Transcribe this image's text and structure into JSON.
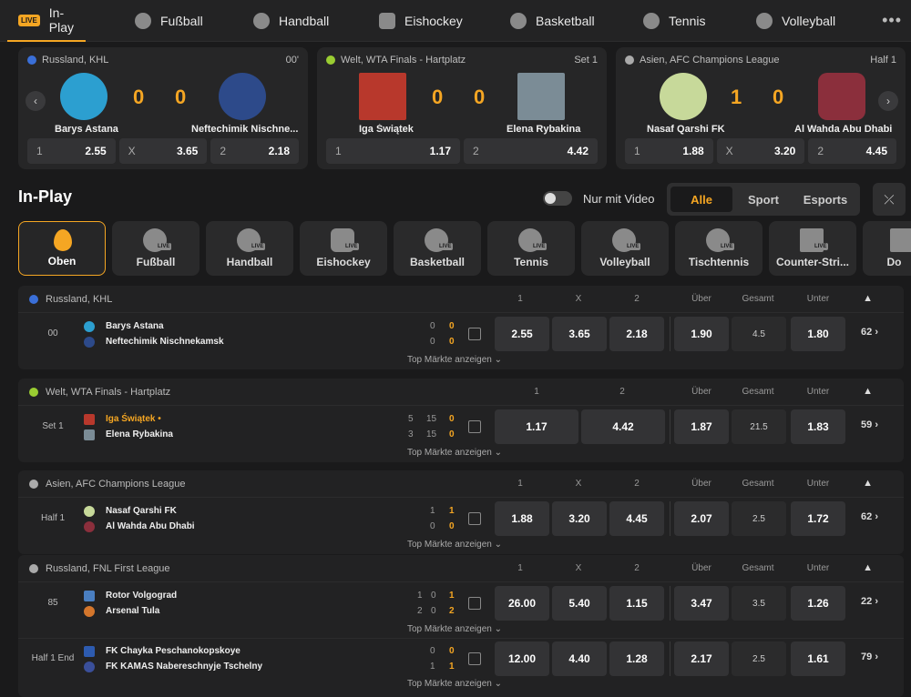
{
  "nav": {
    "items": [
      {
        "label": "In-Play",
        "icon": "live-icon",
        "active": true
      },
      {
        "label": "Fußball",
        "icon": "soccer-ball-icon"
      },
      {
        "label": "Handball",
        "icon": "handball-icon"
      },
      {
        "label": "Eishockey",
        "icon": "hockey-puck-icon"
      },
      {
        "label": "Basketball",
        "icon": "basketball-icon"
      },
      {
        "label": "Tennis",
        "icon": "tennis-ball-icon"
      },
      {
        "label": "Volleyball",
        "icon": "volleyball-icon"
      }
    ],
    "live_badge": "LIVE",
    "more": "•••"
  },
  "featured": [
    {
      "league": "Russland, KHL",
      "status": "00'",
      "home": "Barys Astana",
      "away": "Neftechimik Nischne...",
      "home_score": "0",
      "away_score": "0",
      "odds": [
        {
          "label": "1",
          "value": "2.55"
        },
        {
          "label": "X",
          "value": "3.65"
        },
        {
          "label": "2",
          "value": "2.18"
        }
      ]
    },
    {
      "league": "Welt, WTA Finals - Hartplatz",
      "status": "Set 1",
      "home": "Iga Świątek",
      "away": "Elena Rybakina",
      "home_score": "0",
      "away_score": "0",
      "odds": [
        {
          "label": "1",
          "value": "1.17"
        },
        {
          "label": "2",
          "value": "4.42"
        }
      ]
    },
    {
      "league": "Asien, AFC Champions League",
      "status": "Half 1",
      "home": "Nasaf Qarshi FK",
      "away": "Al Wahda Abu Dhabi",
      "home_score": "1",
      "away_score": "0",
      "odds": [
        {
          "label": "1",
          "value": "1.88"
        },
        {
          "label": "X",
          "value": "3.20"
        },
        {
          "label": "2",
          "value": "4.45"
        }
      ]
    }
  ],
  "inplay": {
    "title": "In-Play",
    "video_toggle_label": "Nur mit Video",
    "filters": [
      "Alle",
      "Sport",
      "Esports"
    ],
    "collapse_icon": "⤫"
  },
  "sports": [
    {
      "label": "Oben",
      "active": true
    },
    {
      "label": "Fußball"
    },
    {
      "label": "Handball"
    },
    {
      "label": "Eishockey"
    },
    {
      "label": "Basketball"
    },
    {
      "label": "Tennis"
    },
    {
      "label": "Volleyball"
    },
    {
      "label": "Tischtennis"
    },
    {
      "label": "Counter-Stri..."
    },
    {
      "label": "Do"
    }
  ],
  "tile_live": "LIVE",
  "top_markets_label": "Top Märkte anzeigen ⌄",
  "groups": [
    {
      "league": "Russland, KHL",
      "headers": {
        "c1": "1",
        "cx": "X",
        "c2": "2",
        "over": "Über",
        "total": "Gesamt",
        "under": "Unter"
      },
      "matches": [
        {
          "status": "00",
          "home": "Barys Astana",
          "away": "Neftechimik Nischnekamsk",
          "home_scores": [
            "0",
            "0"
          ],
          "away_scores": [
            "0",
            "0"
          ],
          "o1": "2.55",
          "ox": "3.65",
          "o2": "2.18",
          "over": "1.90",
          "line": "4.5",
          "under": "1.80",
          "more": "62 ›"
        }
      ]
    },
    {
      "league": "Welt, WTA Finals - Hartplatz",
      "headers": {
        "c1": "1",
        "c2": "2",
        "over": "Über",
        "total": "Gesamt",
        "under": "Unter"
      },
      "matches": [
        {
          "status": "Set 1",
          "home": "Iga Świątek •",
          "away": "Elena Rybakina",
          "home_scores": [
            "5",
            "15",
            "0"
          ],
          "away_scores": [
            "3",
            "15",
            "0"
          ],
          "o1": "1.17",
          "o2": "4.42",
          "over": "1.87",
          "line": "21.5",
          "under": "1.83",
          "more": "59 ›"
        }
      ]
    },
    {
      "league": "Asien, AFC Champions League",
      "headers": {
        "c1": "1",
        "cx": "X",
        "c2": "2",
        "over": "Über",
        "total": "Gesamt",
        "under": "Unter"
      },
      "matches": [
        {
          "status": "Half 1",
          "home": "Nasaf Qarshi FK",
          "away": "Al Wahda Abu Dhabi",
          "home_scores": [
            "1",
            "1"
          ],
          "away_scores": [
            "0",
            "0"
          ],
          "o1": "1.88",
          "ox": "3.20",
          "o2": "4.45",
          "over": "2.07",
          "line": "2.5",
          "under": "1.72",
          "more": "62 ›"
        }
      ]
    },
    {
      "league": "Russland, FNL First League",
      "headers": {
        "c1": "1",
        "cx": "X",
        "c2": "2",
        "over": "Über",
        "total": "Gesamt",
        "under": "Unter"
      },
      "matches": [
        {
          "status": "85",
          "home": "Rotor Volgograd",
          "away": "Arsenal Tula",
          "home_scores": [
            "1",
            "0",
            "1"
          ],
          "away_scores": [
            "2",
            "0",
            "2"
          ],
          "o1": "26.00",
          "ox": "5.40",
          "o2": "1.15",
          "over": "3.47",
          "line": "3.5",
          "under": "1.26",
          "more": "22 ›"
        },
        {
          "status": "Half 1 End",
          "home": "FK Chayka Peschanokopskoye",
          "away": "FK KAMAS Nabereschnyje Tschelny",
          "home_scores": [
            "0",
            "0"
          ],
          "away_scores": [
            "1",
            "1"
          ],
          "o1": "12.00",
          "ox": "4.40",
          "o2": "1.28",
          "over": "2.17",
          "line": "2.5",
          "under": "1.61",
          "more": "79 ›"
        }
      ]
    }
  ],
  "colors": {
    "accent": "#f5a623",
    "bg": "#1a1a1b",
    "card": "#262627"
  }
}
